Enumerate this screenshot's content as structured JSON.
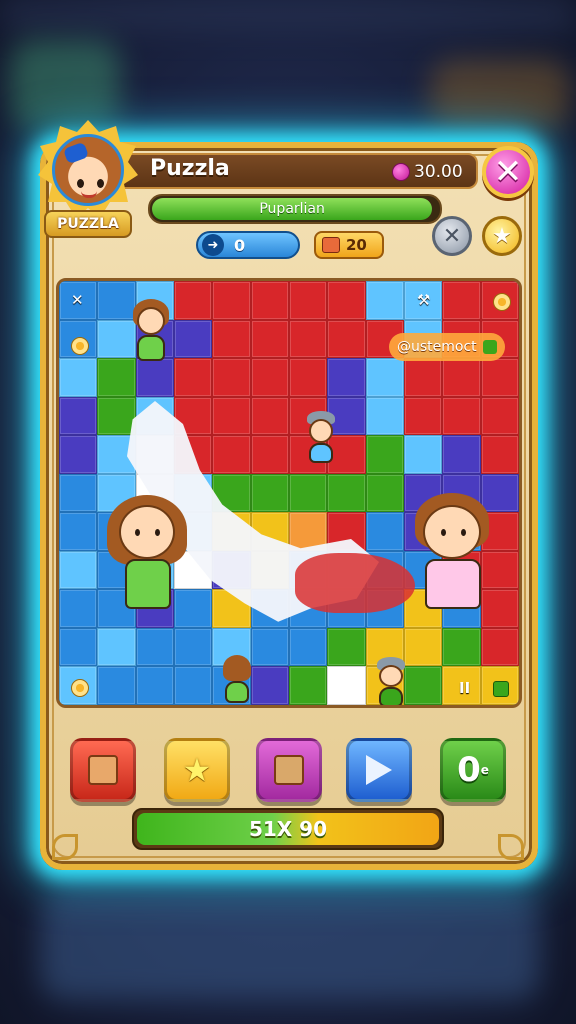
{
  "header": {
    "title": "Puzzla",
    "coin_value": "30.00",
    "badge_label": "PUZZLA"
  },
  "progress": {
    "label": "Puparlian",
    "fraction": 0.98
  },
  "stats": {
    "moves": "0",
    "pieces": "20"
  },
  "board": {
    "tag_label": "@ustemoct",
    "corner_top_left": "✕",
    "corner_top_right": "⚒",
    "corner_bottom_right": "II",
    "palette": [
      "#d8262a",
      "#2a8ae0",
      "#3aa61c",
      "#f2c21a",
      "#4a3cc0",
      "#5fc4ff",
      "#f59a3a",
      "#ffffff"
    ]
  },
  "actions": {
    "buttons": [
      {
        "name": "box-button",
        "icon": "box-icon"
      },
      {
        "name": "star-button",
        "icon": "star-icon"
      },
      {
        "name": "bag-button",
        "icon": "bag-icon"
      },
      {
        "name": "play-button",
        "icon": "play-icon"
      },
      {
        "name": "counter-button",
        "label": "0",
        "sup": "e"
      }
    ]
  },
  "bottom_bar": {
    "label": "51X 90"
  },
  "colors": {
    "glow": "#33e6ff",
    "panel": "#f3e0b4",
    "frame": "#e8b33a",
    "close": "#d21a9e"
  }
}
